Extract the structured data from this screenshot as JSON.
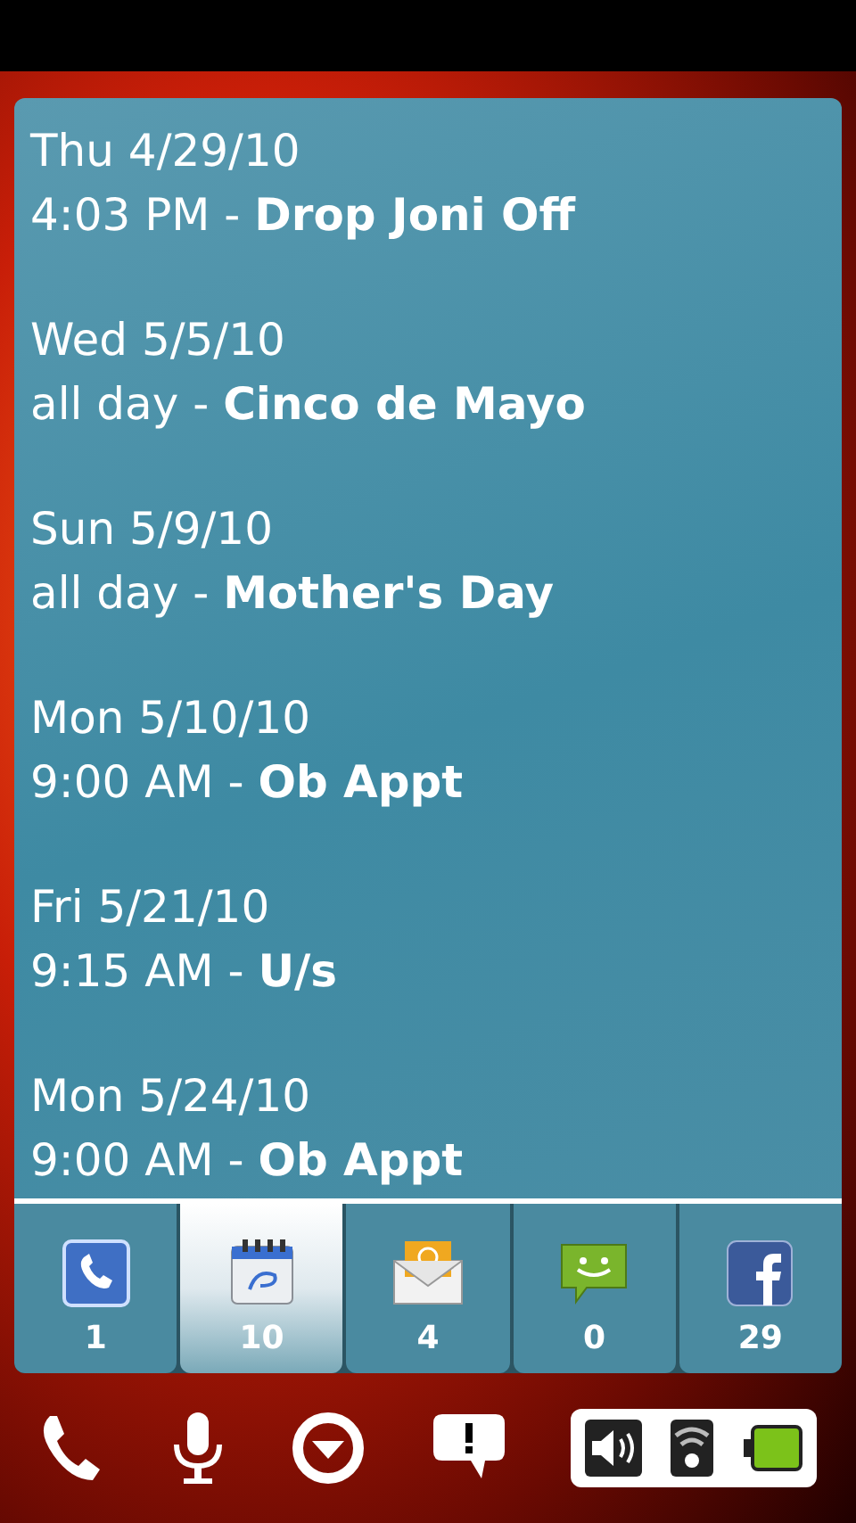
{
  "events": [
    {
      "date": "Thu 4/29/10",
      "line": "4:03 PM - **Drop Joni Off**"
    },
    {
      "date": "Wed 5/5/10",
      "line": "all day - **Cinco de Mayo**"
    },
    {
      "date": "Sun 5/9/10",
      "line": "all day - **Mother's Day**"
    },
    {
      "date": "Mon 5/10/10",
      "line": "9:00 AM - **Ob Appt**"
    },
    {
      "date": "Fri 5/21/10",
      "line": "9:15 AM - **U/s**"
    },
    {
      "date": "Mon 5/24/10",
      "line": "9:00 AM - **Ob Appt**"
    }
  ],
  "tabs": [
    {
      "kind": "phone",
      "count": "1",
      "selected": false
    },
    {
      "kind": "calendar",
      "count": "10",
      "selected": true
    },
    {
      "kind": "email",
      "count": "4",
      "selected": false
    },
    {
      "kind": "sms",
      "count": "0",
      "selected": false
    },
    {
      "kind": "facebook",
      "count": "29",
      "selected": false
    }
  ]
}
